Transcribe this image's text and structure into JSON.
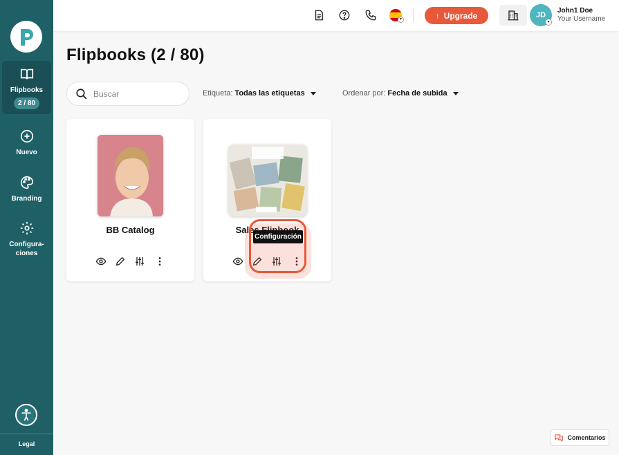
{
  "sidebar": {
    "items": [
      {
        "label": "Flipbooks",
        "count": "2 / 80",
        "icon": "book-open-icon"
      },
      {
        "label": "Nuevo",
        "icon": "plus-circle-icon"
      },
      {
        "label": "Branding",
        "icon": "palette-icon"
      },
      {
        "label": "Configura-\nciones",
        "icon": "gear-icon"
      }
    ],
    "legal": "Legal"
  },
  "header": {
    "upgrade_label": "Upgrade",
    "avatar_initials": "JD",
    "user_name": "John1 Doe",
    "user_subtitle": "Your Username",
    "language": "es"
  },
  "main": {
    "title": "Flipbooks (2 / 80)",
    "search_placeholder": "Buscar",
    "filter_tag_label": "Etiqueta:",
    "filter_tag_value": "Todas las etiquetas",
    "sort_label": "Ordenar por:",
    "sort_value": "Fecha de subida",
    "cards": [
      {
        "title": "BB Catalog"
      },
      {
        "title": "Sales Flipbook"
      }
    ],
    "tooltip": "Configuración",
    "comments_label": "Comentarios"
  },
  "colors": {
    "sidebar_bg": "#1f6067",
    "accent": "#e8583a",
    "avatar": "#4fb5bf"
  }
}
